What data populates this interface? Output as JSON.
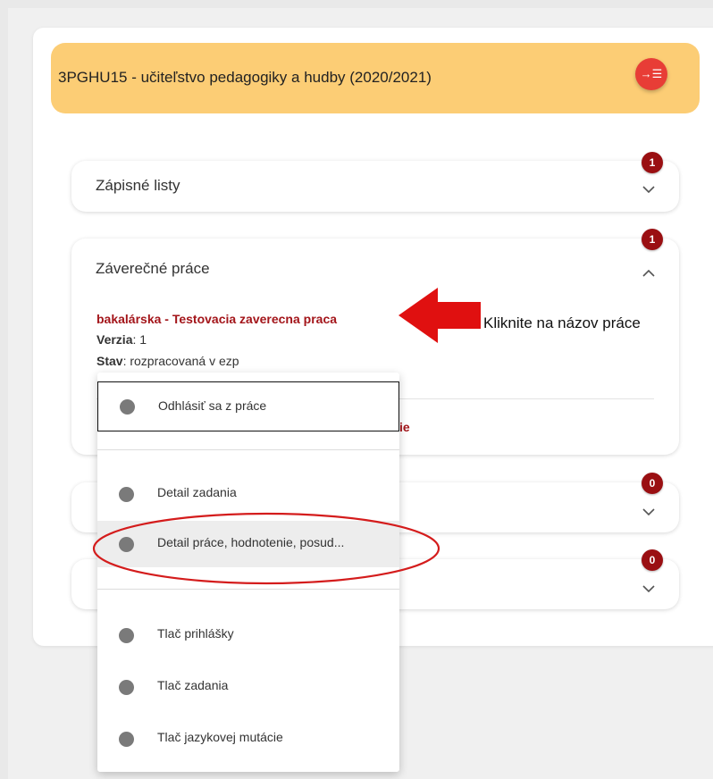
{
  "program": {
    "title": "3PGHU15 - učiteľstvo pedagogiky a hudby (2020/2021)",
    "action_icon": "→☰"
  },
  "sections": {
    "zapisne": {
      "title": "Zápisné listy",
      "badge": "1"
    },
    "zaverecne": {
      "title": "Záverečné práce",
      "badge": "1"
    },
    "third": {
      "badge": "0"
    },
    "fourth": {
      "badge": "0"
    }
  },
  "thesis": {
    "link": "bakalárska - Testovacia zaverecna praca",
    "version_label": "Verzia",
    "version_value": ": 1",
    "status_label": "Stav",
    "status_value": ": rozpracovaná v ezp",
    "hidden_text_peek": "ie"
  },
  "annotation": {
    "text": "Kliknite na názov práce",
    "arrow_color": "#e01010"
  },
  "menu": {
    "items": [
      "Odhlásiť sa z práce",
      "Detail zadania",
      "Detail práce, hodnotenie, posud...",
      "Tlač prihlášky",
      "Tlač zadania",
      "Tlač jazykovej mutácie"
    ]
  },
  "colors": {
    "header_bg": "#fccd75",
    "accent_red": "#e83d36",
    "badge": "#9a0f12",
    "link": "#a3151a",
    "highlight_ellipse": "#d41c1c"
  }
}
